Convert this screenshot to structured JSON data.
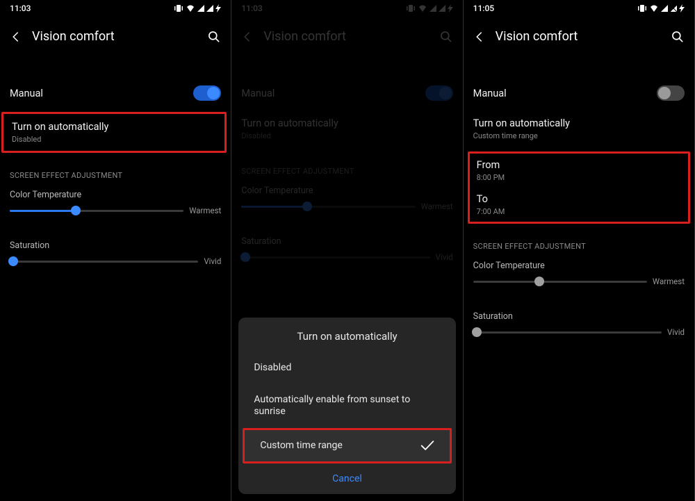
{
  "phone1": {
    "time": "11:03",
    "title": "Vision comfort",
    "manual": "Manual",
    "auto_label": "Turn on automatically",
    "auto_sub": "Disabled",
    "section": "SCREEN EFFECT ADJUSTMENT",
    "ct_label": "Color Temperature",
    "ct_end": "Warmest",
    "sat_label": "Saturation",
    "sat_end": "Vivid"
  },
  "phone2": {
    "time": "11:03",
    "title": "Vision comfort",
    "manual": "Manual",
    "auto_label": "Turn on automatically",
    "auto_sub": "Disabled",
    "section": "SCREEN EFFECT ADJUSTMENT",
    "ct_label": "Color Temperature",
    "ct_end": "Warmest",
    "sat_label": "Saturation",
    "sat_end": "Vivid",
    "dialog": {
      "title": "Turn on automatically",
      "opt0": "Disabled",
      "opt1": "Automatically enable from sunset to sunrise",
      "opt2": "Custom time range",
      "cancel": "Cancel"
    }
  },
  "phone3": {
    "time": "11:05",
    "title": "Vision comfort",
    "manual": "Manual",
    "auto_label": "Turn on automatically",
    "auto_sub": "Custom time range",
    "from_label": "From",
    "from_val": "8:00 PM",
    "to_label": "To",
    "to_val": "7:00 AM",
    "section": "SCREEN EFFECT ADJUSTMENT",
    "ct_label": "Color Temperature",
    "ct_end": "Warmest",
    "sat_label": "Saturation",
    "sat_end": "Vivid"
  }
}
